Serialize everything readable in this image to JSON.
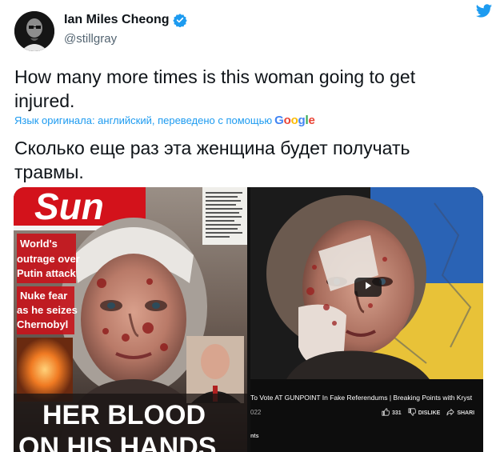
{
  "author": {
    "name": "Ian Miles Cheong",
    "handle": "@stillgray",
    "verified": true
  },
  "icons": {
    "logo": "bird-icon",
    "verified": "verified-badge-icon",
    "play": "play-icon",
    "like": "thumbs-up-icon",
    "dislike": "thumbs-down-icon",
    "share": "share-icon"
  },
  "colors": {
    "accent": "#1d9bf0",
    "text": "#0f1419",
    "muted": "#536471"
  },
  "tweet": {
    "text": "How many more times is this woman going to get injured.",
    "translation_note": "Язык оригинала: английский, переведено с помощью",
    "translation_provider": [
      "G",
      "o",
      "o",
      "g",
      "l",
      "e"
    ],
    "translated_text": "Сколько еще раз эта женщина будет получать травмы."
  },
  "media": {
    "left": {
      "masthead": "Sun",
      "headline_1": "World's",
      "headline_2": "outrage over",
      "headline_3": "Putin attack",
      "headline_4": "Nuke fear",
      "headline_5": "as he seizes",
      "headline_6": "Chernobyl",
      "banner_1": "HER BLOOD",
      "banner_2": "ON HIS HANDS"
    },
    "right": {
      "caption": "To Vote AT GUNPOINT In Fake Referendums | Breaking Points with Kryst",
      "year": "022",
      "likes": "331",
      "dislike_label": "DISLIKE",
      "share_label": "SHARI",
      "channel": "nts"
    }
  }
}
